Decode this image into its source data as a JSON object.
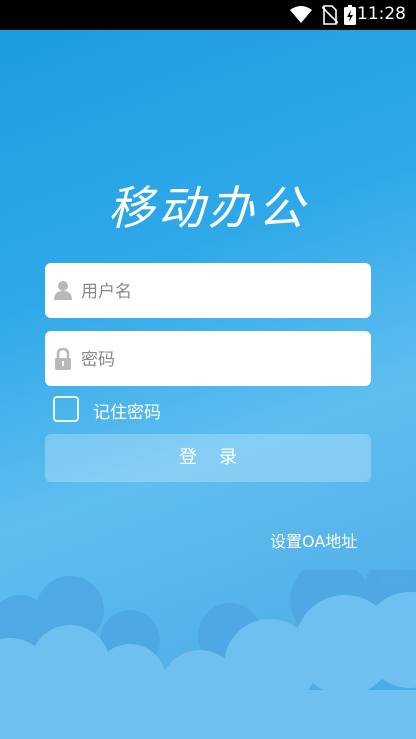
{
  "status_bar": {
    "time": "11:28",
    "icons": [
      "wifi-icon",
      "no-sim-icon",
      "battery-charging-icon"
    ]
  },
  "app": {
    "title": "移动办公"
  },
  "login_form": {
    "username_placeholder": "用户名",
    "password_placeholder": "密码",
    "remember_label": "记住密码",
    "remember_checked": false,
    "login_label": "登录",
    "oa_link_label": "设置OA地址"
  },
  "colors": {
    "background_top": "#1a9be0",
    "background_bottom": "#5fbef0",
    "status_bar": "#000000",
    "field_bg": "#ffffff",
    "cloud": "#6fc0ef"
  }
}
